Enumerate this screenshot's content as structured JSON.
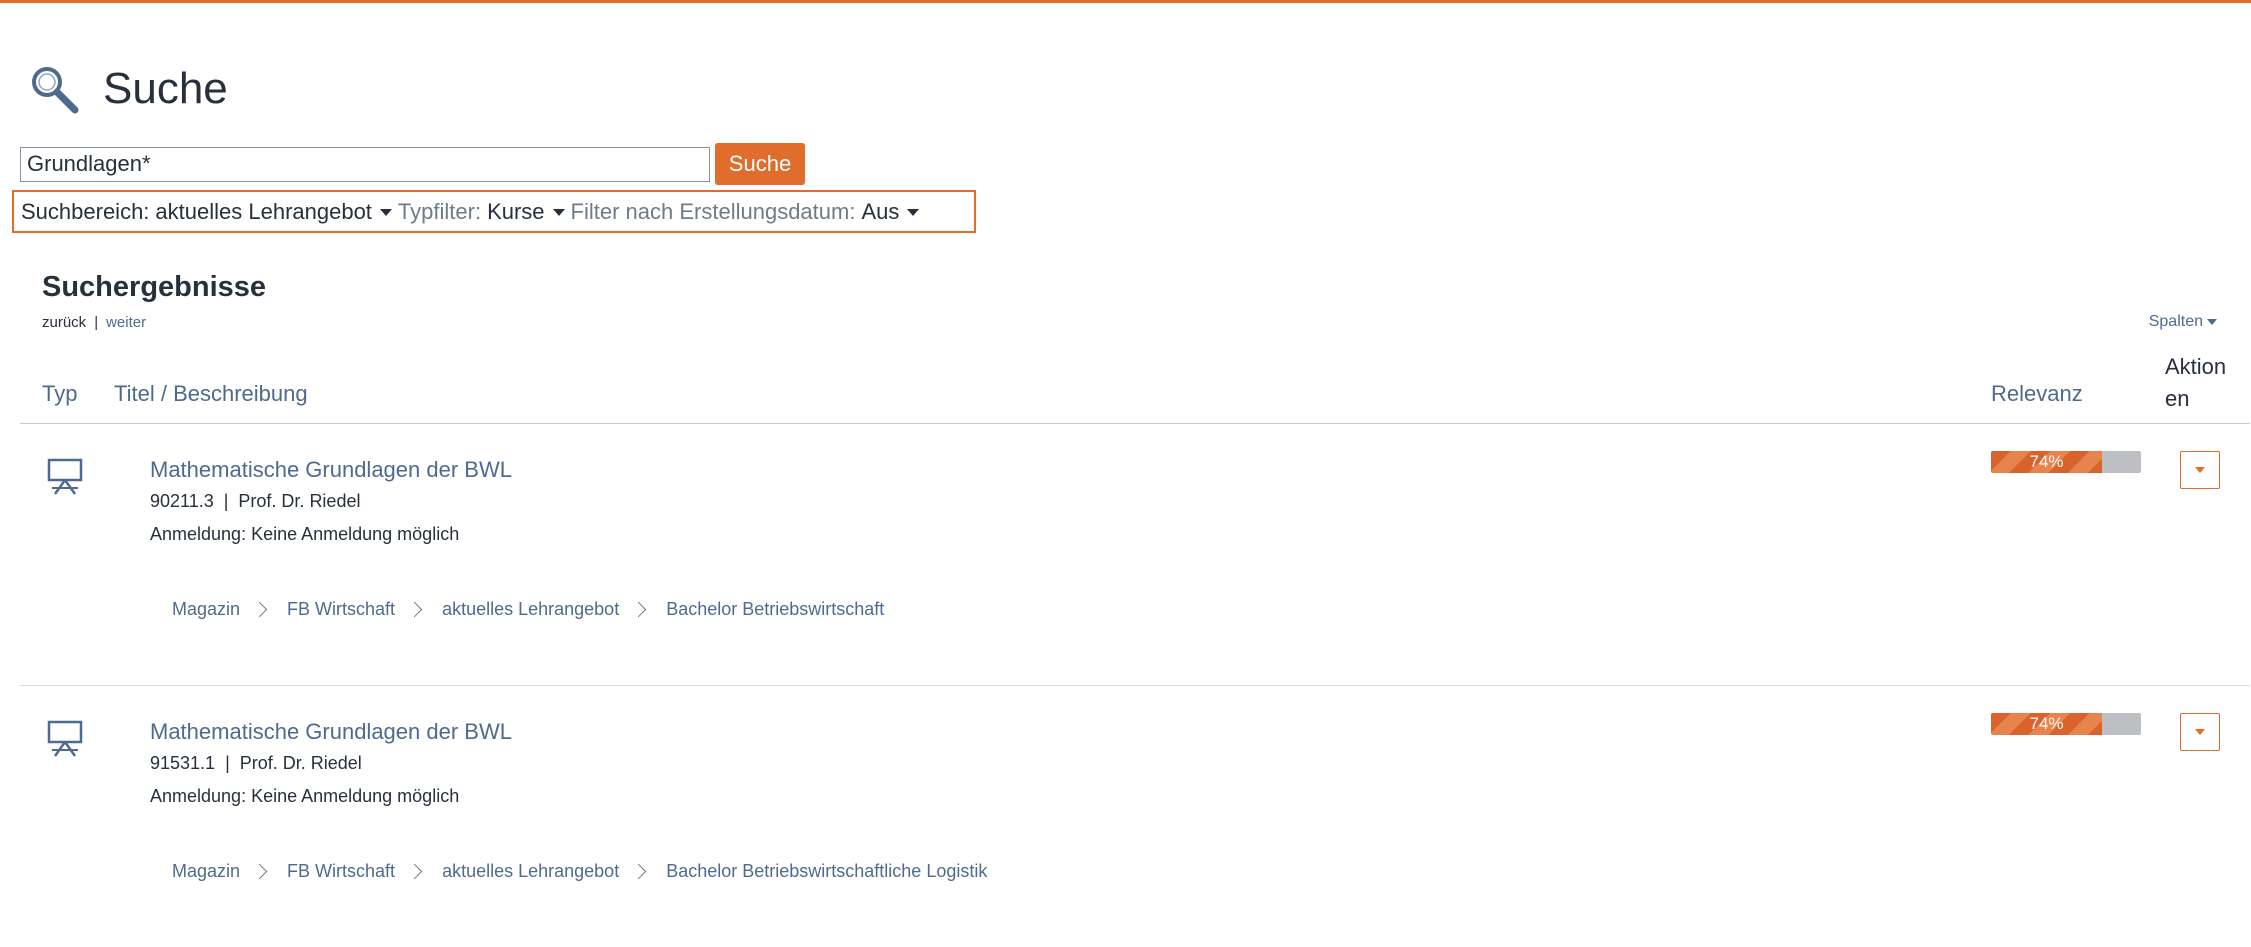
{
  "page": {
    "title": "Suche"
  },
  "search": {
    "value": "Grundlagen*",
    "button_label": "Suche"
  },
  "filters": {
    "scope_label": "Suchbereich:",
    "scope_value": "aktuelles Lehrangebot",
    "type_label": "Typfilter:",
    "type_value": "Kurse",
    "date_label": "Filter nach Erstellungsdatum:",
    "date_value": "Aus"
  },
  "results": {
    "heading": "Suchergebnisse",
    "back_label": "zurück",
    "separator": "|",
    "next_label": "weiter",
    "columns_label": "Spalten",
    "columns": {
      "typ": "Typ",
      "titel": "Titel / Beschreibung",
      "relevanz": "Relevanz",
      "aktionen": "Aktionen"
    },
    "items": [
      {
        "title": "Mathematische Grundlagen der BWL",
        "number": "90211.3",
        "lecturer": "Prof. Dr. Riedel",
        "registration": "Anmeldung: Keine Anmeldung möglich",
        "relevance_label": "74%",
        "relevance": 0.74,
        "breadcrumb": [
          "Magazin",
          "FB Wirtschaft",
          "aktuelles Lehrangebot",
          "Bachelor Betriebswirtschaft"
        ]
      },
      {
        "title": "Mathematische Grundlagen der BWL",
        "number": "91531.1",
        "lecturer": "Prof. Dr. Riedel",
        "registration": "Anmeldung: Keine Anmeldung möglich",
        "relevance_label": "74%",
        "relevance": 0.74,
        "breadcrumb": [
          "Magazin",
          "FB Wirtschaft",
          "aktuelles Lehrangebot",
          "Bachelor Betriebswirtschaftliche Logistik"
        ]
      }
    ]
  },
  "colors": {
    "accent": "#e06d2b",
    "link": "#4f6a8f",
    "text": "#28303c"
  }
}
